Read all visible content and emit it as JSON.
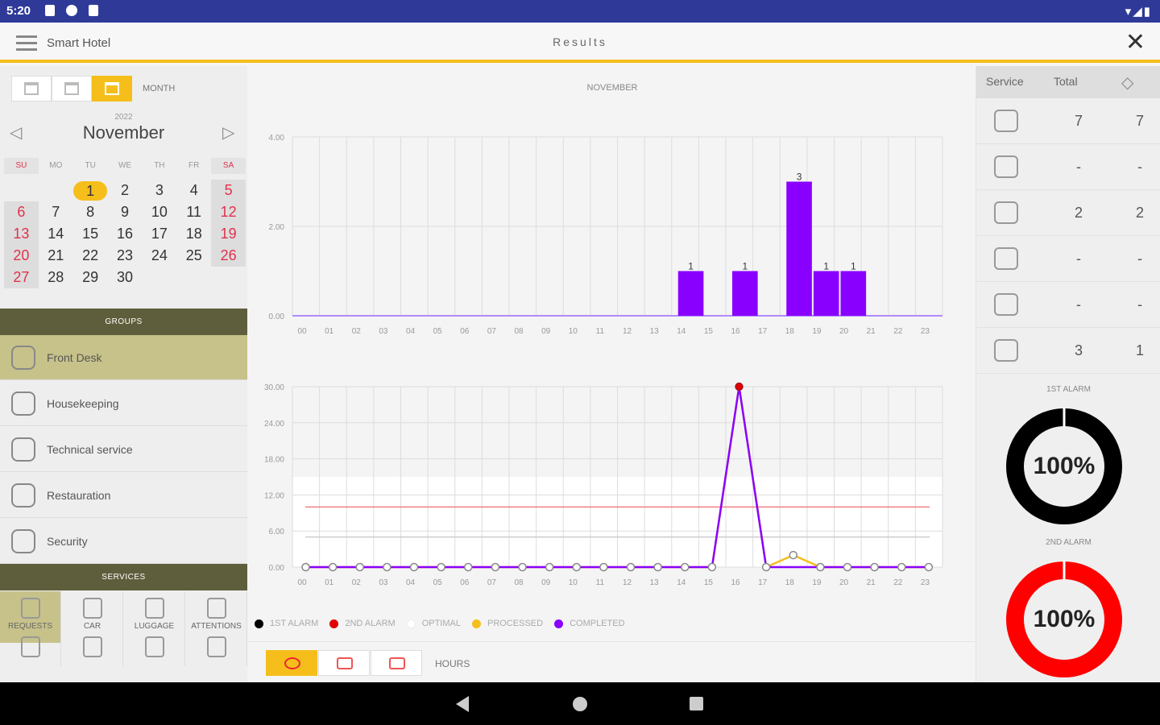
{
  "status_bar": {
    "time": "5:20"
  },
  "app_bar": {
    "app_name": "Smart Hotel",
    "title": "Results"
  },
  "calendar": {
    "view_mode_label": "MONTH",
    "year": "2022",
    "month": "November",
    "weekdays": [
      "SU",
      "MO",
      "TU",
      "WE",
      "TH",
      "FR",
      "SA"
    ],
    "weeks": [
      [
        "",
        "",
        "1",
        "2",
        "3",
        "4",
        "5"
      ],
      [
        "6",
        "7",
        "8",
        "9",
        "10",
        "11",
        "12"
      ],
      [
        "13",
        "14",
        "15",
        "16",
        "17",
        "18",
        "19"
      ],
      [
        "20",
        "21",
        "22",
        "23",
        "24",
        "25",
        "26"
      ],
      [
        "27",
        "28",
        "29",
        "30",
        "",
        "",
        ""
      ]
    ],
    "selected_day": "1"
  },
  "groups": {
    "header": "GROUPS",
    "items": [
      {
        "label": "Front Desk",
        "icon": "concierge-icon",
        "active": true
      },
      {
        "label": "Housekeeping",
        "icon": "maid-icon",
        "active": false
      },
      {
        "label": "Technical service",
        "icon": "technician-icon",
        "active": false
      },
      {
        "label": "Restauration",
        "icon": "cutlery-icon",
        "active": false
      },
      {
        "label": "Security",
        "icon": "id-card-icon",
        "active": false
      }
    ]
  },
  "services": {
    "header": "SERVICES",
    "items": [
      {
        "label": "REQUESTS",
        "icon": "bellboy-icon",
        "active": true
      },
      {
        "label": "CAR",
        "icon": "car-icon",
        "active": false
      },
      {
        "label": "LUGGAGE",
        "icon": "luggage-icon",
        "active": false
      },
      {
        "label": "ATTENTIONS",
        "icon": "gift-icon",
        "active": false
      },
      {
        "label": "",
        "icon": "warning-icon",
        "active": false
      },
      {
        "label": "",
        "icon": "cancel-circle-icon",
        "active": false
      },
      {
        "label": "",
        "icon": "lightbulb-icon",
        "active": false
      },
      {
        "label": "",
        "icon": "plumbing-icon",
        "active": false
      }
    ]
  },
  "chart_data": [
    {
      "type": "bar",
      "title": "NOVEMBER",
      "categories": [
        "00",
        "01",
        "02",
        "03",
        "04",
        "05",
        "06",
        "07",
        "08",
        "09",
        "10",
        "11",
        "12",
        "13",
        "14",
        "15",
        "16",
        "17",
        "18",
        "19",
        "20",
        "21",
        "22",
        "23"
      ],
      "values": [
        0,
        0,
        0,
        0,
        0,
        0,
        0,
        0,
        0,
        0,
        0,
        0,
        0,
        0,
        1,
        0,
        1,
        0,
        3,
        1,
        1,
        0,
        0,
        0
      ],
      "y_ticks": [
        "0.00",
        "2.00",
        "4.00"
      ],
      "ylim": [
        0,
        4
      ],
      "color": "#8a00ff",
      "grid": true
    },
    {
      "type": "line",
      "categories": [
        "00",
        "01",
        "02",
        "03",
        "04",
        "05",
        "06",
        "07",
        "08",
        "09",
        "10",
        "11",
        "12",
        "13",
        "14",
        "15",
        "16",
        "17",
        "18",
        "19",
        "20",
        "21",
        "22",
        "23"
      ],
      "y_ticks": [
        "0.00",
        "6.00",
        "12.00",
        "18.00",
        "24.00",
        "30.00"
      ],
      "ylim": [
        0,
        30
      ],
      "threshold_lines": [
        {
          "value": 10,
          "color": "#f08080"
        },
        {
          "value": 5,
          "color": "#cccccc"
        }
      ],
      "series": [
        {
          "name": "PROCESSED",
          "color": "#f5be1a",
          "values": [
            0,
            0,
            0,
            0,
            0,
            0,
            0,
            0,
            0,
            0,
            0,
            0,
            0,
            0,
            0,
            0,
            30,
            0,
            2,
            0,
            0,
            0,
            0,
            0
          ]
        },
        {
          "name": "COMPLETED",
          "color": "#8a00ff",
          "values": [
            0,
            0,
            0,
            0,
            0,
            0,
            0,
            0,
            0,
            0,
            0,
            0,
            0,
            0,
            0,
            0,
            30,
            0,
            0,
            0,
            0,
            0,
            0,
            0
          ]
        }
      ],
      "alarm_points": [
        {
          "x": "16",
          "value": 30,
          "color": "#e00000"
        }
      ],
      "legend": [
        {
          "label": "1ST ALARM",
          "color": "#000000"
        },
        {
          "label": "2ND ALARM",
          "color": "#e00000"
        },
        {
          "label": "OPTIMAL",
          "color": "#ffffff"
        },
        {
          "label": "PROCESSED",
          "color": "#f5be1a"
        },
        {
          "label": "COMPLETED",
          "color": "#8a00ff"
        }
      ]
    }
  ],
  "bottom_bar": {
    "label": "HOURS"
  },
  "summary": {
    "headers": {
      "service": "Service",
      "total": "Total"
    },
    "rows": [
      {
        "icon": "bellboy-icon",
        "v1": "7",
        "v2": "7"
      },
      {
        "icon": "car-icon",
        "v1": "-",
        "v2": "-"
      },
      {
        "icon": "luggage-icon",
        "v1": "2",
        "v2": "2"
      },
      {
        "icon": "gift-icon",
        "v1": "-",
        "v2": "-"
      },
      {
        "icon": "warning-icon",
        "v1": "-",
        "v2": "-"
      },
      {
        "icon": "cancel-circle-icon",
        "v1": "3",
        "v2": "1"
      }
    ],
    "alarm1": {
      "label": "1ST ALARM",
      "value": "100%",
      "color": "#000000"
    },
    "alarm2": {
      "label": "2ND ALARM",
      "value": "100%",
      "color": "#ff0000"
    }
  }
}
